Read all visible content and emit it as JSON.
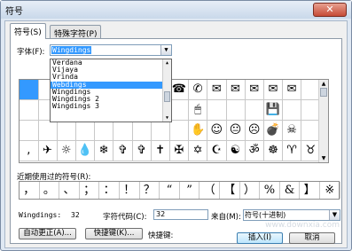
{
  "window": {
    "title": "符号",
    "close_glyph": "✕"
  },
  "tabs": [
    "符号(S)",
    "特殊字符(P)"
  ],
  "font": {
    "label": "字体(F):",
    "value": "Wingdings",
    "options": [
      "Verdana",
      "Vijaya",
      "Vrinda",
      "Webdings",
      "Wingdings",
      "Wingdings 2",
      "Wingdings 3"
    ],
    "selected_option": "Webdings"
  },
  "symbol_grid": {
    "rows": [
      [
        "",
        "",
        "",
        "",
        "",
        "",
        "",
        "",
        "☎",
        "✆",
        "✉",
        "✉",
        "✉",
        "✉",
        "✉",
        "",
        ""
      ],
      [
        "",
        "",
        "",
        "",
        "",
        "",
        "",
        "",
        "",
        "🖱",
        "",
        "",
        "",
        "💾",
        "",
        "",
        ""
      ],
      [
        "",
        "",
        "",
        "",
        "",
        "",
        "",
        "",
        "",
        "✋",
        "☺",
        "😐",
        "☹",
        "💣",
        "☠",
        "",
        ""
      ],
      [
        ",",
        "✈",
        "☼",
        "💧",
        "❄",
        "✞",
        "✞",
        "✝",
        "✠",
        "✡",
        "☪",
        "☯",
        "ॐ",
        "☸",
        "♈",
        "♉",
        ""
      ]
    ]
  },
  "recent": {
    "label": "近期使用过的符号(R):",
    "symbols": [
      "，",
      "。",
      "、",
      "；",
      "：",
      "！",
      "？",
      "“",
      "”",
      "（",
      "【",
      "）",
      "%",
      "&",
      "】",
      "※"
    ]
  },
  "info": {
    "font_name": "Wingdings:",
    "char_value": "32",
    "char_code_label": "字符代码(C):",
    "char_code": "32",
    "from_label": "来自(M):",
    "from_value": "符号(十进制)"
  },
  "buttons": {
    "autocorrect": "自动更正(A)...",
    "shortcut": "快捷键(K)...",
    "shortcut_label": "快捷键:",
    "insert": "插入(I)",
    "cancel": "取消"
  },
  "watermark": "www.downxia.com"
}
